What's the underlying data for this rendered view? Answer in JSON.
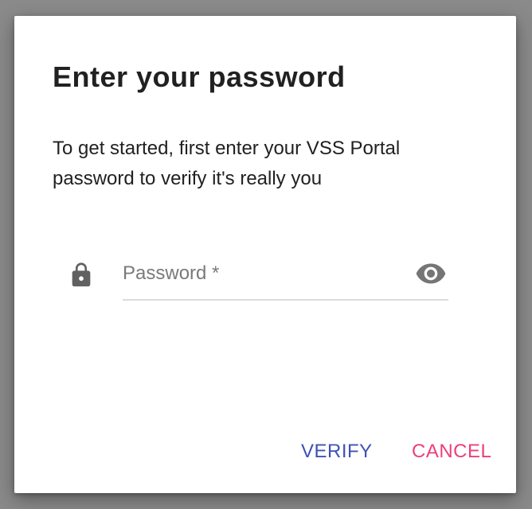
{
  "dialog": {
    "title": "Enter your password",
    "description": "To get started, first enter your VSS Portal password to verify it's really you",
    "password_field": {
      "placeholder": "Password *",
      "value": ""
    },
    "icons": {
      "lock": "lock-icon",
      "visibility": "eye-icon"
    },
    "actions": {
      "verify_label": "VERIFY",
      "cancel_label": "CANCEL"
    },
    "colors": {
      "primary": "#3f51b5",
      "accent": "#ec407a",
      "icon": "#616161",
      "backdrop": "#8a8a8a"
    }
  }
}
